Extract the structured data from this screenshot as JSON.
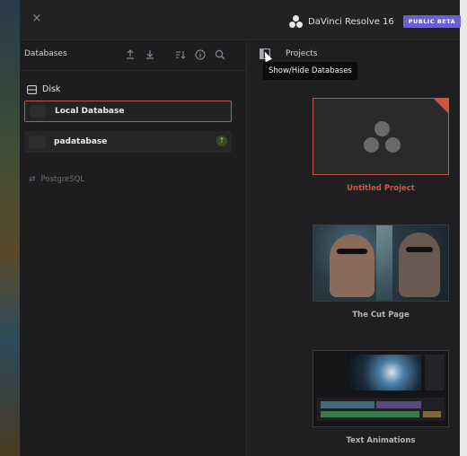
{
  "titlebar": {
    "close_label": "×",
    "app_name": "DaVinci Resolve 16",
    "badge": "PUBLIC BETA",
    "badge_color": "#6e5fd0"
  },
  "databases_panel": {
    "title": "Databases",
    "toolbar_icons": [
      "upload-icon",
      "download-icon",
      "sort-icon",
      "info-icon",
      "search-icon"
    ],
    "section_label": "Disk",
    "items": [
      {
        "name": "Local Database",
        "selected": true
      },
      {
        "name": "padatabase",
        "selected": false,
        "status_icon": "upgrade-arrow-icon"
      }
    ],
    "postgres_label": "PostgreSQL"
  },
  "projects_panel": {
    "title": "Projects",
    "toggle_tooltip": "Show/Hide Databases",
    "projects": [
      {
        "name": "Untitled Project",
        "selected": true
      },
      {
        "name": "The Cut Page",
        "selected": false
      },
      {
        "name": "Text Animations",
        "selected": false
      }
    ]
  },
  "colors": {
    "accent": "#d2563f",
    "selection_border": "#c05a44",
    "upgrade_green": "#a6d04c"
  }
}
